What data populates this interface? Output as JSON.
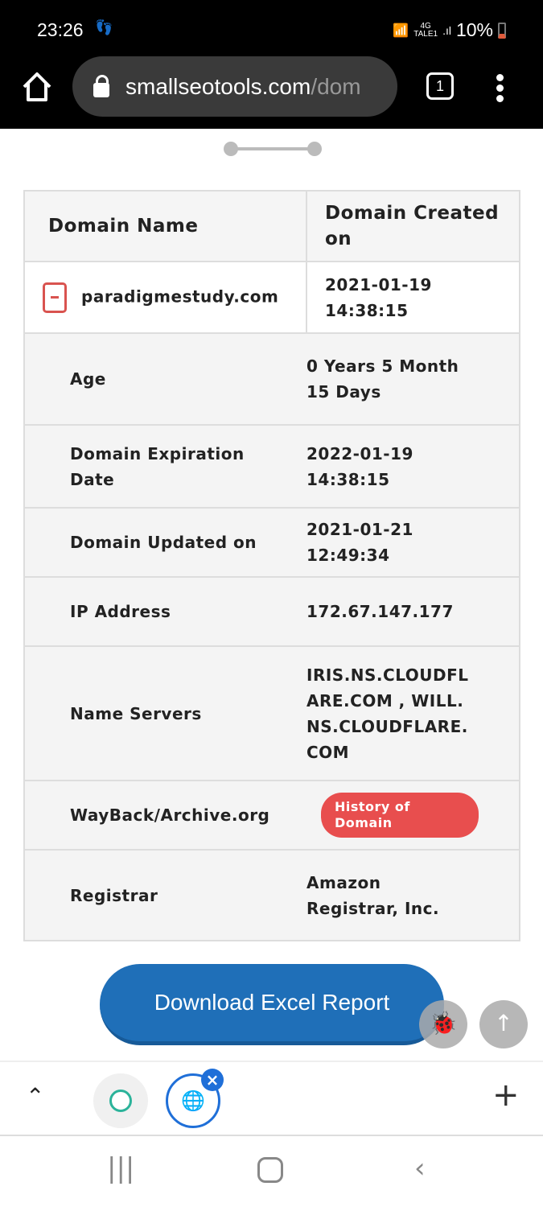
{
  "status": {
    "time": "23:26",
    "network": "4G",
    "carrier": "TALE1",
    "battery": "10%"
  },
  "browser": {
    "url_host": "smallseotools.com",
    "url_path": "/dom",
    "tab_count": "1"
  },
  "table": {
    "headers": [
      "Domain Name",
      "Domain Created on"
    ],
    "domain": "paradigmestudy.com",
    "created": "2021-01-19 14:38:15",
    "rows": [
      {
        "label": "Age",
        "value": "0 Years 5 Month 15 Days"
      },
      {
        "label": "Domain Expiration Date",
        "value": "2022-01-19 14:38:15"
      },
      {
        "label": "Domain Updated on",
        "value": "2021-01-21 12:49:34"
      },
      {
        "label": "IP Address",
        "value": "172.67.147.177"
      },
      {
        "label": "Name Servers",
        "value": "IRIS.NS.CLOUDFLARE.COM , WILL.NS.CLOUDFLARE.COM"
      },
      {
        "label": "WayBack/Archive.org",
        "button": "History of Domain"
      },
      {
        "label": "Registrar",
        "value": "Amazon Registrar, Inc."
      }
    ]
  },
  "download_label": "Download Excel Report",
  "colors": {
    "accent": "#1f6fb8",
    "history_button": "#e84e4e",
    "collapse_icon": "#d9534f"
  }
}
